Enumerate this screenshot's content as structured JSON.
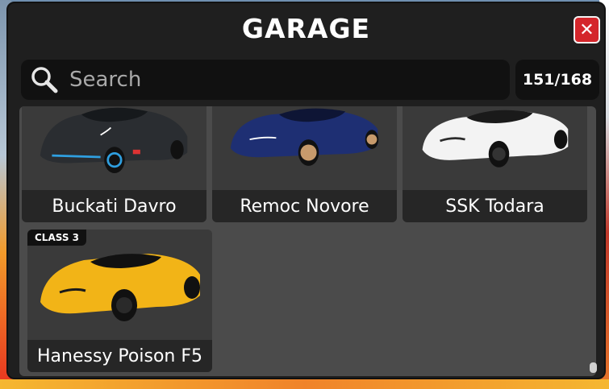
{
  "window": {
    "title": "GARAGE"
  },
  "search": {
    "placeholder": "Search",
    "value": ""
  },
  "vehicle_count": "151/168",
  "colors": {
    "close_button": "#d4262b",
    "panel": "#1f1f1f",
    "card_label": "#262626"
  },
  "vehicles": [
    {
      "name": "Buckati Davro",
      "color": "#2a2d31",
      "accent": "#2f9fe0"
    },
    {
      "name": "Remoc Novore",
      "color": "#1e2f73",
      "accent": "#c79a6c"
    },
    {
      "name": "SSK Todara",
      "color": "#f3f3f3",
      "accent": "#2b2b2b"
    },
    {
      "name": "Hanessy Poison F5",
      "badge": "CLASS 3",
      "color": "#f2b417",
      "accent": "#111111"
    }
  ],
  "icons": {
    "search": "magnifier-icon",
    "close": "close-icon"
  }
}
